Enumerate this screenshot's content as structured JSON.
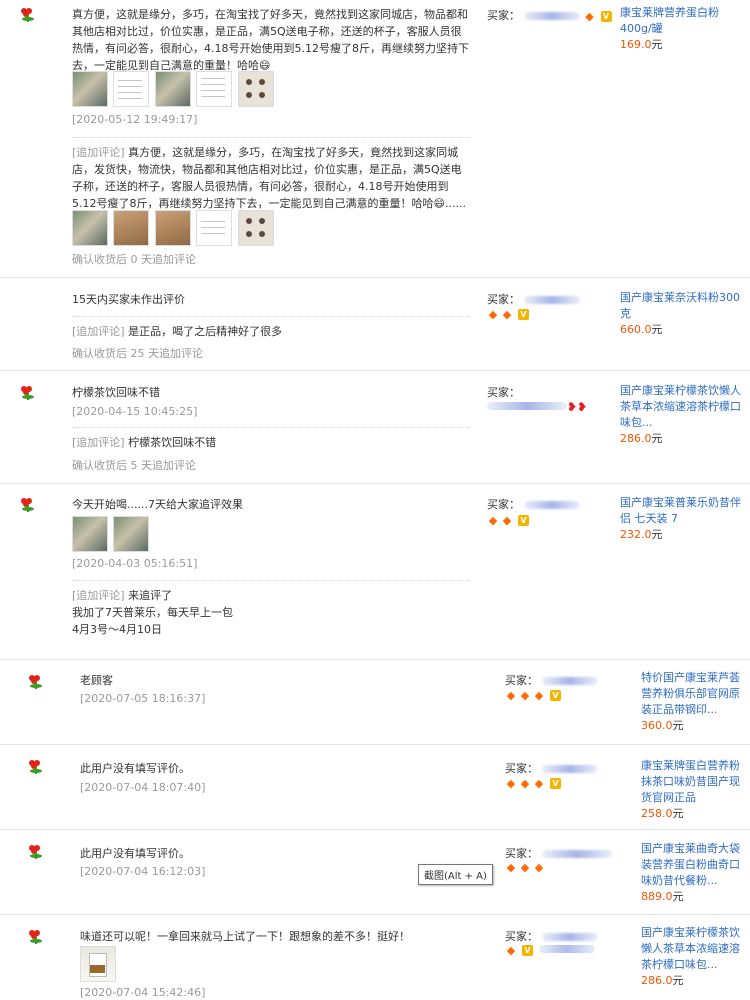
{
  "reviews": [
    {
      "comment": "真方便，这就是缘分，多巧，在淘宝找了好多天，竟然找到这家同城店，物品都和其他店相对比过，价位实惠，是正品，满5Q送电子称，还送的杯子，客服人员很热情，有问必答，很耐心，4.18号开始使用到5.12号瘦了8斤，再继续努力坚持下去，一定能见到自己满意的重量！哈哈😄",
      "date": "[2020-05-12 19:49:17]",
      "append_tag": "[追加评论]",
      "append_text": "真方便，这就是缘分，多巧，在淘宝找了好多天，竟然找到这家同城店，发货快，物流快，物品都和其他店相对比过，价位实惠，是正品，满5Q送电子称，还送的杯子，客服人员很热情，有问必答，很耐心，4.18号开始使用到5.12号瘦了8斤，再继续努力坚持下去，一定能见到自己满意的重量！哈哈😄......",
      "append_note": "确认收货后 0 天追加评论",
      "buyer_label": "买家：",
      "product_name": "康宝莱牌营养蛋白粉400g/罐",
      "price": "169.0",
      "yuan": "元"
    },
    {
      "comment": "15天内买家未作出评价",
      "append_tag": "[追加评论]",
      "append_text": "是正品，喝了之后精神好了很多",
      "append_note": "确认收货后 25 天追加评论",
      "buyer_label": "买家：",
      "product_name": "国产康宝莱奈沃料粉300克",
      "price": "660.0",
      "yuan": "元"
    },
    {
      "comment": "柠檬茶饮回味不错",
      "date": "[2020-04-15 10:45:25]",
      "append_tag": "[追加评论]",
      "append_text": "柠檬茶饮回味不错",
      "append_note": "确认收货后 5 天追加评论",
      "buyer_label": "买家：",
      "product_name": "国产康宝莱柠檬茶饮懒人茶草本浓缩速溶茶柠檬口味包...",
      "price": "286.0",
      "yuan": "元"
    },
    {
      "comment": "今天开始喝......7天给大家追评效果",
      "date": "[2020-04-03 05:16:51]",
      "append_tag": "[追加评论]",
      "append_text": "来追评了",
      "append_lines": [
        "我加了7天普莱乐，每天早上一包",
        "4月3号～4月10日"
      ],
      "buyer_label": "买家：",
      "product_name": "国产康宝莱普莱乐奶昔伴侣 七天装 7",
      "price": "232.0",
      "yuan": "元"
    },
    {
      "comment": "老顾客",
      "date": "[2020-07-05 18:16:37]",
      "buyer_label": "买家：",
      "product_name": "特价国产康宝莱芦荟营养粉俱乐部官网原装正品带钢印...",
      "price": "360.0",
      "yuan": "元"
    },
    {
      "comment": "此用户没有填写评价。",
      "date": "[2020-07-04 18:07:40]",
      "buyer_label": "买家：",
      "product_name": "康宝莱牌蛋白营养粉抹茶口味奶昔国产现货官网正品",
      "price": "258.0",
      "yuan": "元"
    },
    {
      "comment": "此用户没有填写评价。",
      "date": "[2020-07-04 16:12:03]",
      "buyer_label": "买家：",
      "product_name": "国产康宝莱曲奇大袋装营养蛋白粉曲奇口味奶昔代餐粉...",
      "price": "889.0",
      "yuan": "元"
    },
    {
      "comment": "味道还可以呢！一拿回来就马上试了一下！跟想象的差不多！挺好！",
      "date": "[2020-07-04 15:42:46]",
      "buyer_label": "买家：",
      "product_name": "国产康宝莱柠檬茶饮懒人茶草本浓缩速溶茶柠檬口味包...",
      "price": "286.0",
      "yuan": "元"
    }
  ],
  "tooltip": "截图(Alt + A)",
  "icons": {
    "rating": "red-flower-icon",
    "credit": "diamond-icon",
    "vip": "vip-icon",
    "heart": "heart-icon"
  },
  "colors": {
    "link": "#2e6cc3",
    "price": "#f25500",
    "diamond": "#ff6a00",
    "flower": "#e2231a"
  }
}
